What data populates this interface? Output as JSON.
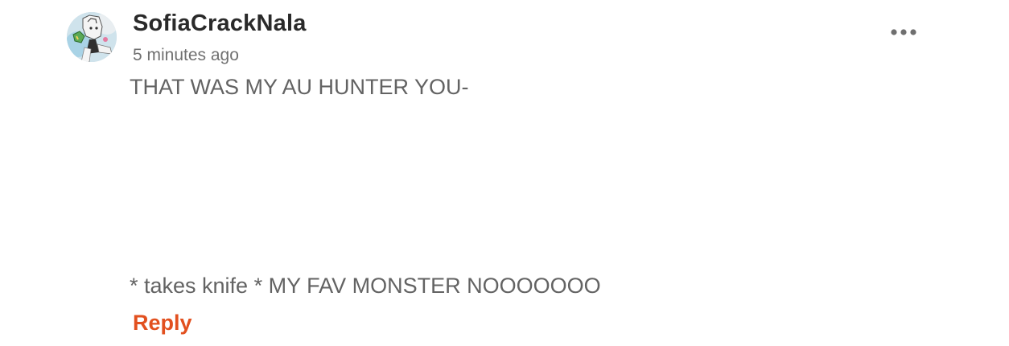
{
  "comment": {
    "username": "SofiaCrackNala",
    "timestamp": "5 minutes ago",
    "body_lines": [
      "THAT WAS MY AU HUNTER YOU-",
      "* takes knife * MY FAV MONSTER NOOOOOOO"
    ],
    "reply_label": "Reply",
    "avatar_icon": "user-avatar",
    "more_icon": "more-options-icon"
  },
  "colors": {
    "accent": "#e2501f",
    "username": "#2a2a2a",
    "timestamp": "#707070",
    "body_text": "#636363",
    "more_dots": "#6f6f6f"
  }
}
